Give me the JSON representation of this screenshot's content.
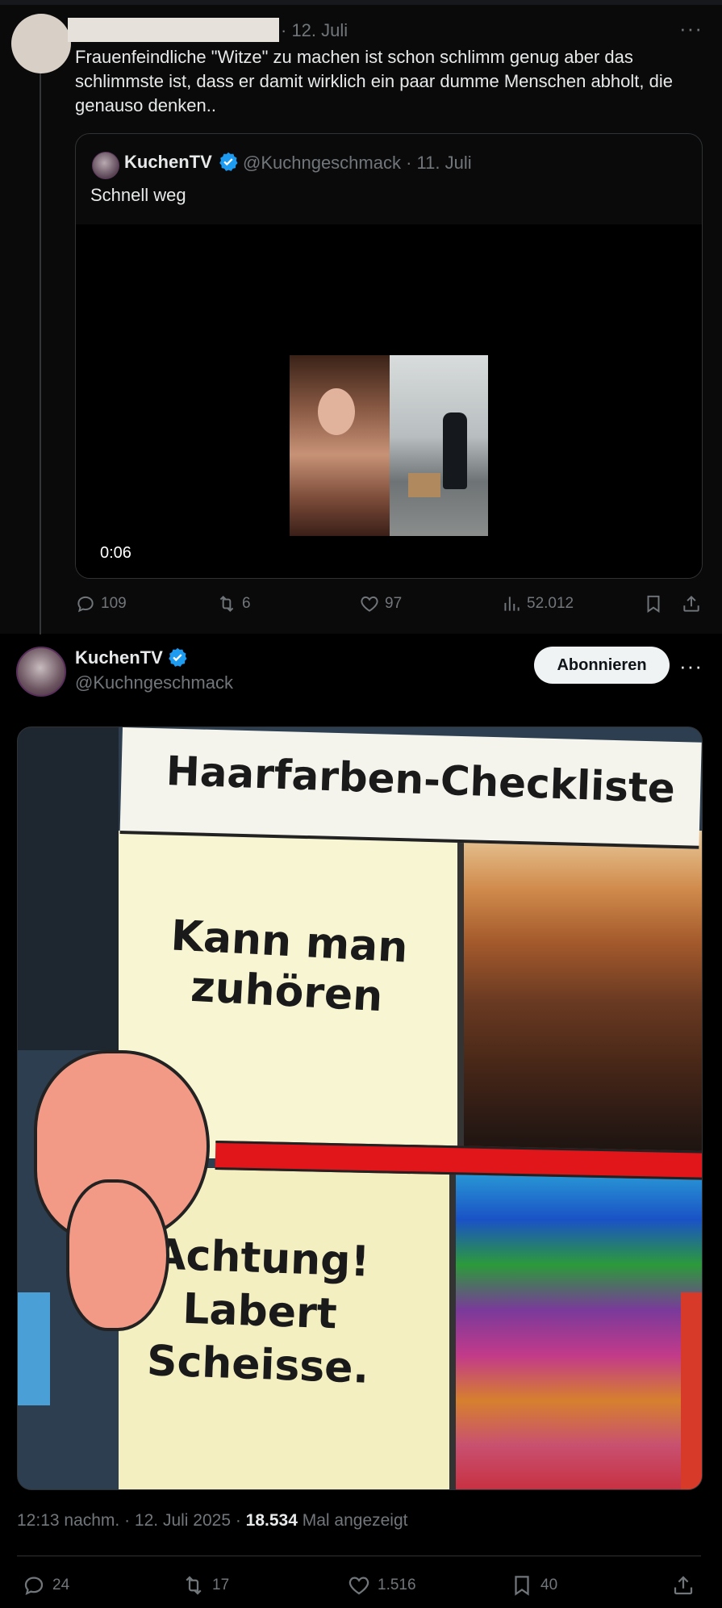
{
  "reply": {
    "date": "· 12. Juli",
    "more": "···",
    "text": "Frauenfeindliche \"Witze\" zu machen ist schon schlimm genug aber das schlimmste ist, dass er damit wirklich ein paar dumme Menschen abholt, die genauso denken..",
    "actions": {
      "replies": "109",
      "reposts": "6",
      "likes": "97",
      "views": "52.012"
    }
  },
  "quote": {
    "name": "KuchenTV",
    "handle": "@Kuchngeschmack · 11. Juli",
    "text": "Schnell weg",
    "video_time": "0:06"
  },
  "main": {
    "name": "KuchenTV",
    "handle": "@Kuchngeschmack",
    "follow_label": "Abonnieren",
    "more": "···",
    "meme": {
      "title": "Haarfarben-Checkliste",
      "top_text": "Kann man zuhören",
      "bottom_text": "Achtung! Labert Scheisse."
    },
    "meta": {
      "time": "12:13 nachm. · 12. Juli 2025 · ",
      "views": "18.534",
      "views_label": " Mal angezeigt"
    },
    "actions": {
      "replies": "24",
      "reposts": "17",
      "likes": "1.516",
      "bookmarks": "40"
    }
  },
  "colors": {
    "verified": "#1d9bf0",
    "muted": "#71767b",
    "text": "#e7e9ea"
  },
  "icons": [
    "reply-icon",
    "repost-icon",
    "like-icon",
    "views-icon",
    "bookmark-icon",
    "share-icon",
    "verified-icon"
  ]
}
